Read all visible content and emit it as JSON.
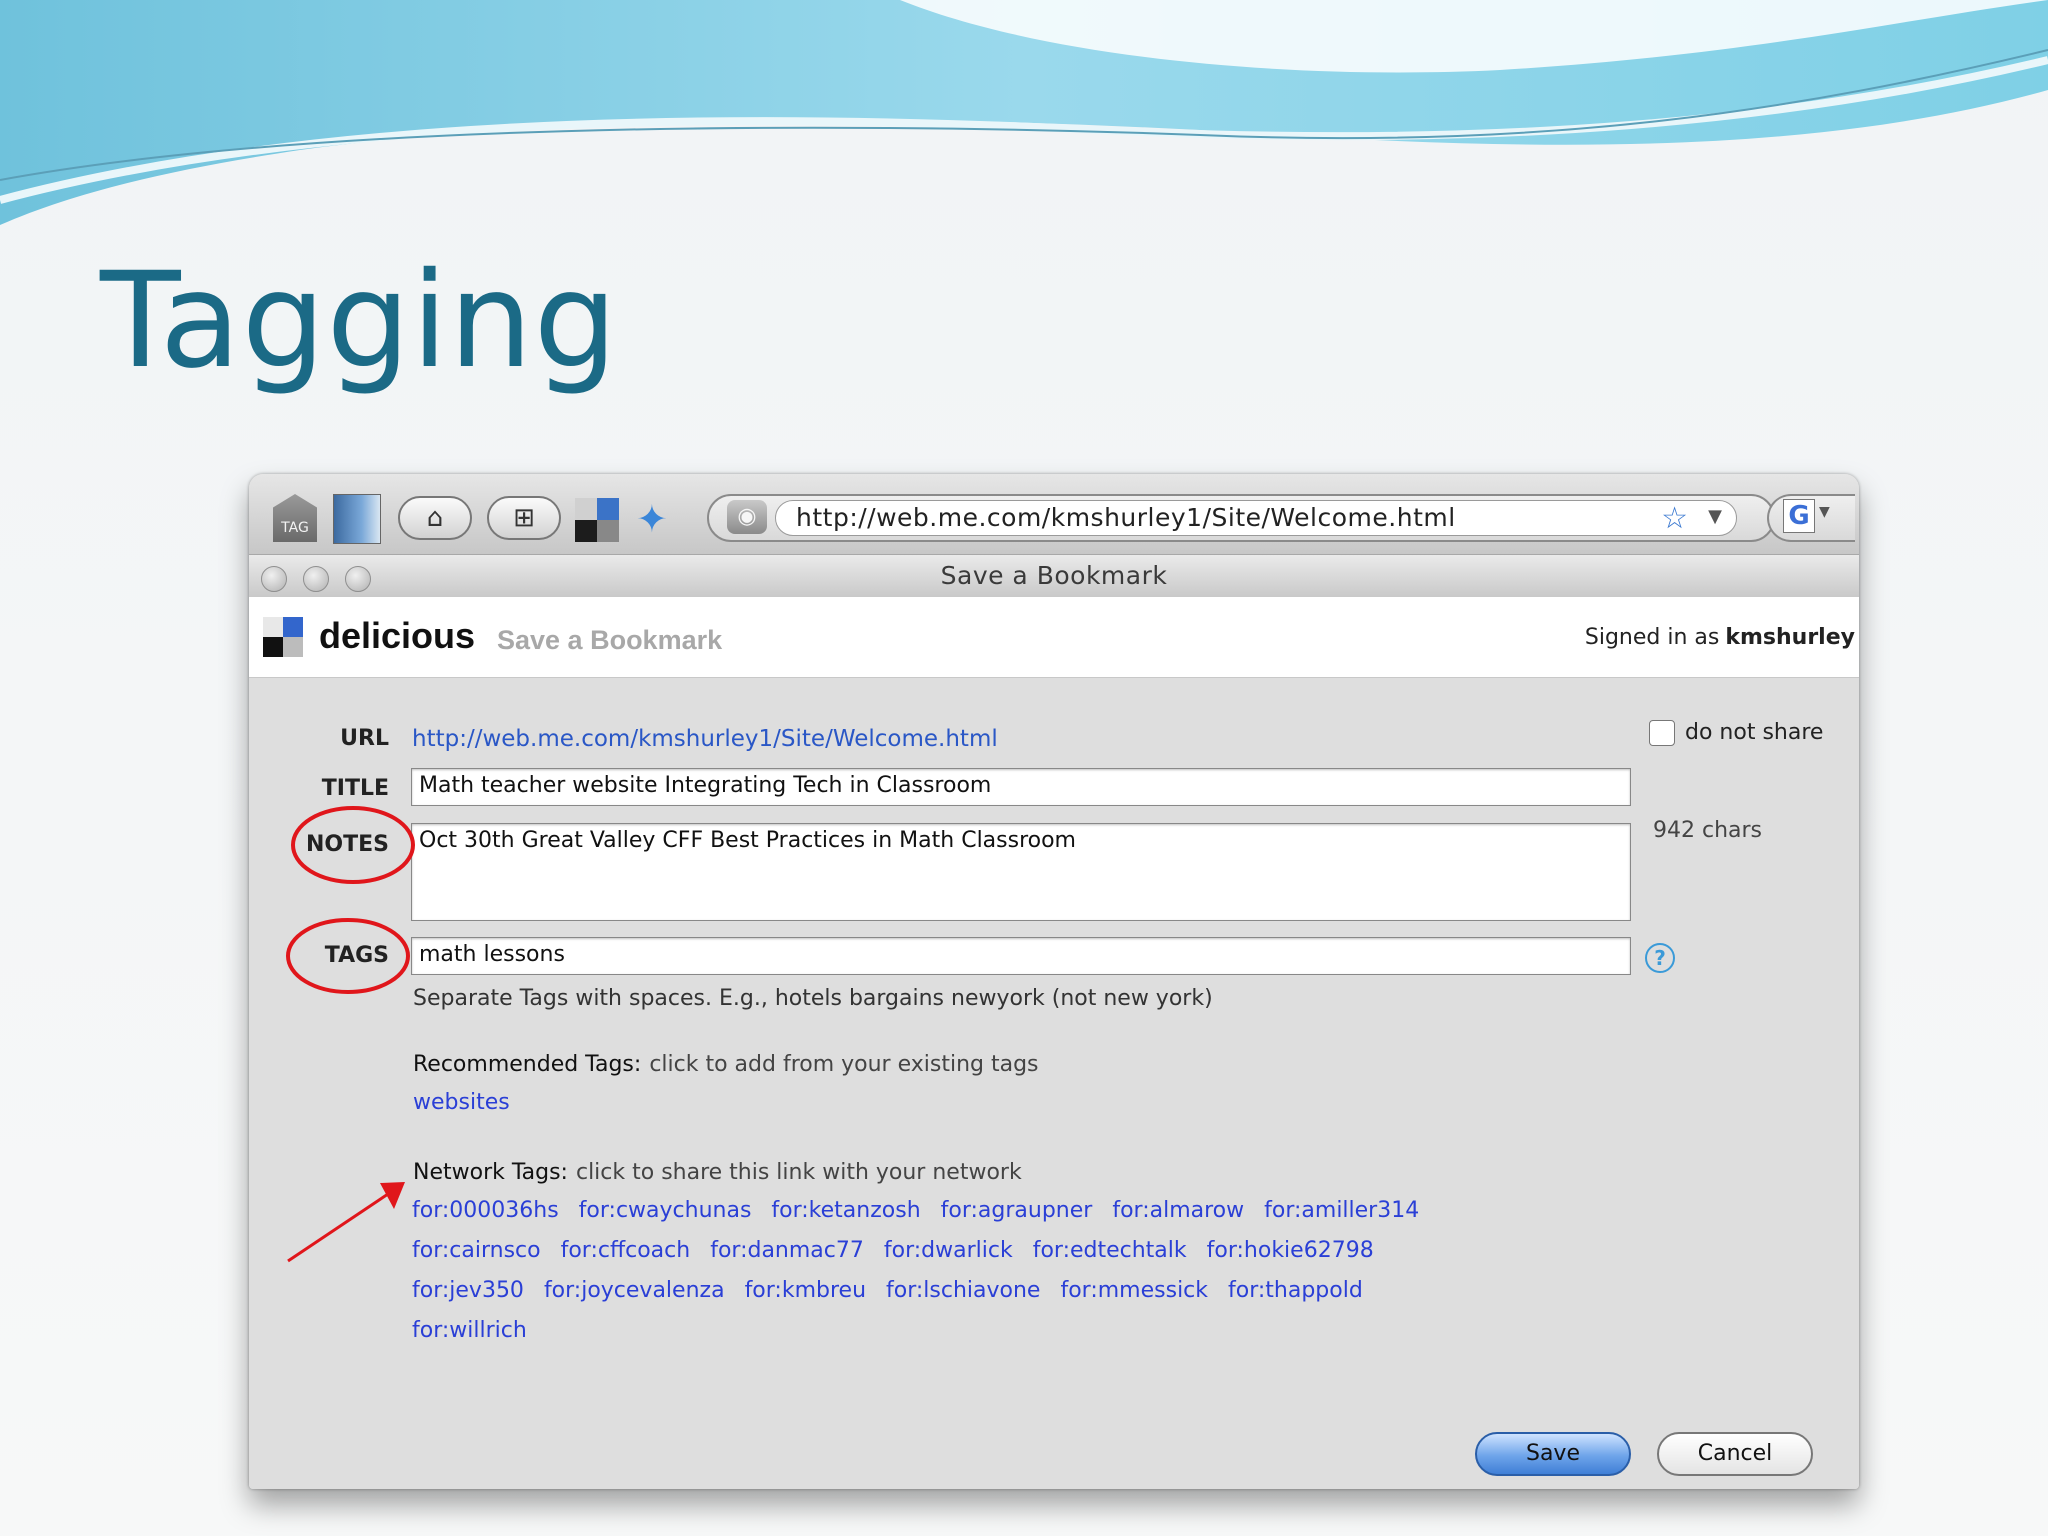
{
  "slide": {
    "title": "Tagging"
  },
  "toolbar": {
    "tag_icon_label": "TAG",
    "address": "http://web.me.com/kmshurley1/Site/Welcome.html",
    "search_engine_letter": "G"
  },
  "window": {
    "title": "Save a Bookmark"
  },
  "header": {
    "brand": "delicious",
    "subtitle": "Save a Bookmark",
    "signed_in_prefix": "Signed in as",
    "username": "kmshurley"
  },
  "form": {
    "url_label": "URL",
    "url_value": "http://web.me.com/kmshurley1/Site/Welcome.html",
    "title_label": "TITLE",
    "title_value": "Math teacher website Integrating Tech in Classroom",
    "notes_label": "NOTES",
    "notes_value": "Oct 30th Great Valley CFF Best Practices in Math Classroom",
    "tags_label": "TAGS",
    "tags_value": "math lessons",
    "do_not_share_label": "do not share",
    "do_not_share_checked": false,
    "chars_remaining": "942 chars",
    "tags_hint": "Separate Tags with spaces. E.g., hotels bargains newyork (not new york)",
    "recommended_title": "Recommended Tags:",
    "recommended_desc": "click to add from your existing tags",
    "recommended_tags": [
      "websites"
    ],
    "network_title": "Network Tags:",
    "network_desc": "click to share this link with your network",
    "network_rows": [
      [
        "for:000036hs",
        "for:cwaychunas",
        "for:ketanzosh",
        "for:agraupner",
        "for:almarow",
        "for:amiller314"
      ],
      [
        "for:cairnsco",
        "for:cffcoach",
        "for:danmac77",
        "for:dwarlick",
        "for:edtechtalk",
        "for:hokie62798"
      ],
      [
        "for:jev350",
        "for:joycevalenza",
        "for:kmbreu",
        "for:lschiavone",
        "for:mmessick",
        "for:thappold"
      ],
      [
        "for:willrich"
      ]
    ],
    "save_label": "Save",
    "cancel_label": "Cancel"
  },
  "colors": {
    "slide_title": "#1b6a86",
    "link": "#2a57c6",
    "network_link": "#2a3fd6",
    "annotation": "#e0161b"
  }
}
